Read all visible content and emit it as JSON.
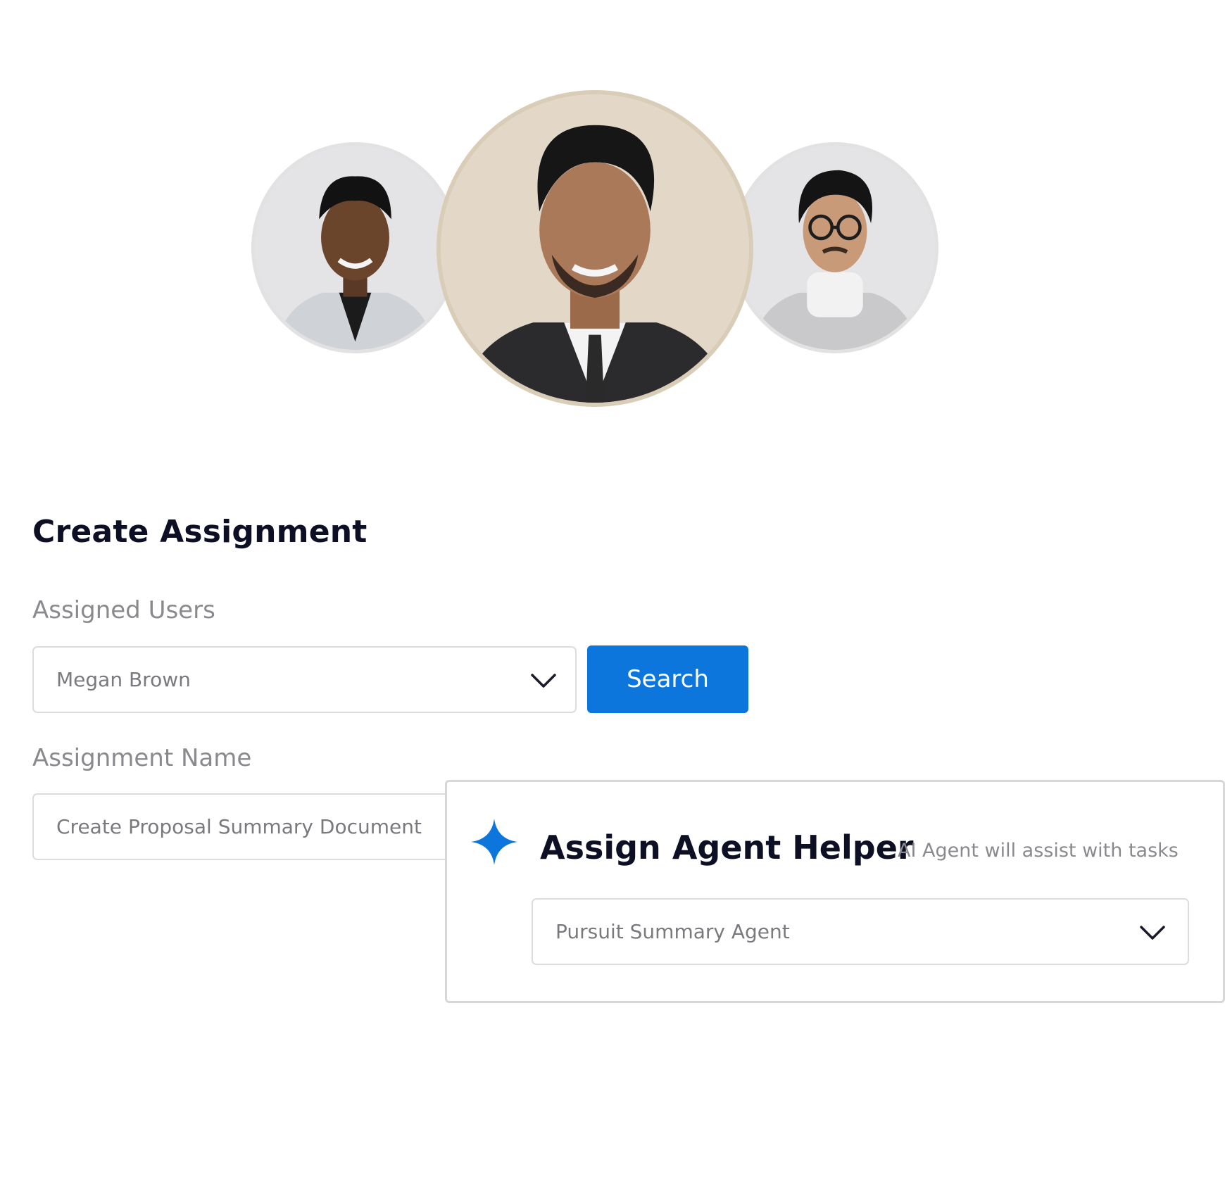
{
  "avatars": [
    {
      "name": "woman-avatar",
      "icon": "person-photo"
    },
    {
      "name": "man-avatar-center",
      "icon": "person-photo"
    },
    {
      "name": "man-glasses-avatar",
      "icon": "person-photo"
    }
  ],
  "form": {
    "title": "Create Assignment",
    "assigned_users": {
      "label": "Assigned Users",
      "value": "Megan Brown",
      "search_label": "Search"
    },
    "assignment_name": {
      "label": "Assignment Name",
      "value": "Create Proposal Summary Document"
    }
  },
  "agent_helper": {
    "icon": "sparkle-icon",
    "title": "Assign Agent Helper",
    "subtitle": "AI Agent will assist with tasks",
    "agent_value": "Pursuit Summary Agent"
  },
  "colors": {
    "accent": "#0d76dc",
    "title_text": "#0d0f24",
    "muted_text": "#8a8a8e",
    "border": "#dcdcdc"
  }
}
